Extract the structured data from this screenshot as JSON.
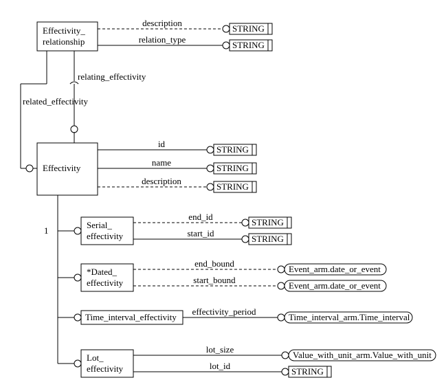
{
  "entities": {
    "effectivity_relationship": {
      "line1": "Effectivity_",
      "line2": "relationship"
    },
    "effectivity": {
      "label": "Effectivity"
    },
    "serial_effectivity": {
      "line1": "Serial_",
      "line2": "effectivity"
    },
    "dated_effectivity": {
      "line1": "*Dated_",
      "line2": "effectivity"
    },
    "time_interval_effectivity": {
      "label": "Time_interval_effectivity"
    },
    "lot_effectivity": {
      "line1": "Lot_",
      "line2": "effectivity"
    }
  },
  "relations": {
    "description": "description",
    "relation_type": "relation_type",
    "relating_effectivity": "relating_effectivity",
    "related_effectivity": "related_effectivity",
    "id": "id",
    "name": "name",
    "end_id": "end_id",
    "start_id": "start_id",
    "end_bound": "end_bound",
    "start_bound": "start_bound",
    "effectivity_period": "effectivity_period",
    "lot_size": "lot_size",
    "lot_id": "lot_id",
    "one": "1"
  },
  "types": {
    "string": "STRING",
    "event_arm_date_or_event": "Event_arm.date_or_event",
    "time_interval_arm": "Time_interval_arm.Time_interval",
    "value_with_unit_arm": "Value_with_unit_arm.Value_with_unit"
  }
}
